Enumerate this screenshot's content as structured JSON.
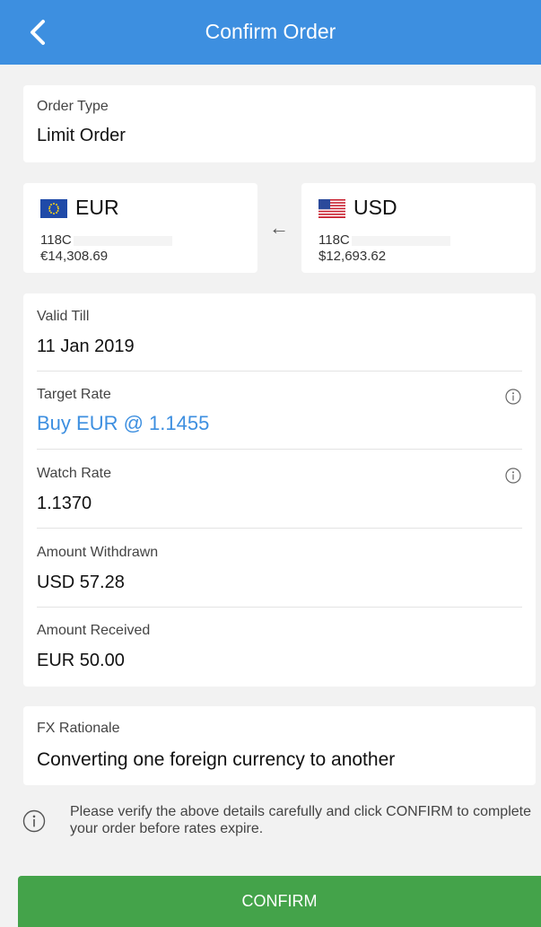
{
  "header": {
    "title": "Confirm Order"
  },
  "order_type": {
    "label": "Order Type",
    "value": "Limit Order"
  },
  "from_currency": {
    "code": "EUR",
    "account": "118C",
    "balance": "€14,308.69",
    "flag_icon": "eu-flag-icon"
  },
  "to_currency": {
    "code": "USD",
    "account": "118C",
    "balance": "$12,693.62",
    "flag_icon": "us-flag-icon"
  },
  "details": {
    "valid_till": {
      "label": "Valid Till",
      "value": "11 Jan 2019"
    },
    "target_rate": {
      "label": "Target Rate",
      "value": "Buy EUR @ 1.1455"
    },
    "watch_rate": {
      "label": "Watch Rate",
      "value": "1.1370"
    },
    "amount_withdrawn": {
      "label": "Amount Withdrawn",
      "value": "USD 57.28"
    },
    "amount_received": {
      "label": "Amount Received",
      "value": "EUR 50.00"
    }
  },
  "rationale": {
    "label": "FX Rationale",
    "value": "Converting one foreign currency to another"
  },
  "notice": {
    "text": "Please verify the above details carefully and click CONFIRM to complete your order before rates expire."
  },
  "confirm_button": {
    "label": "CONFIRM"
  },
  "colors": {
    "header": "#3d8fe0",
    "accent": "#3d8fe0",
    "confirm": "#44a34a",
    "background": "#f2f2f2"
  }
}
